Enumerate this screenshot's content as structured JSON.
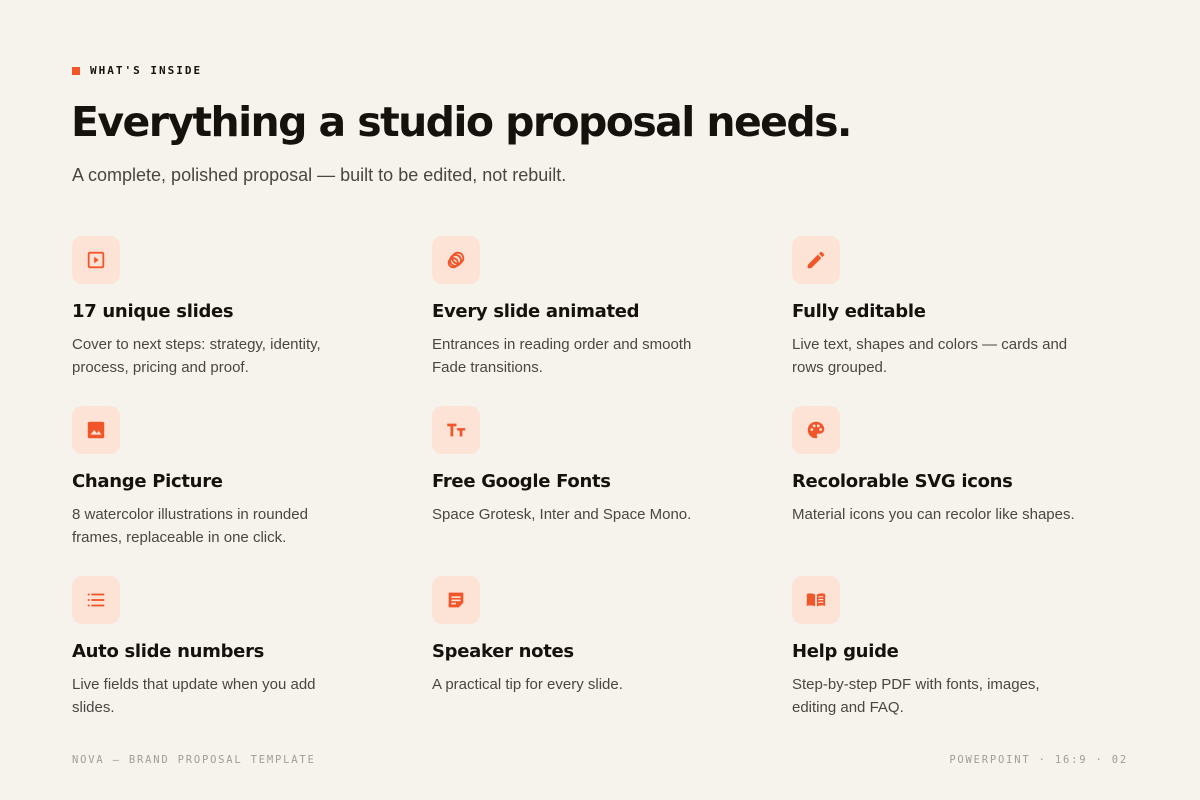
{
  "eyebrow": "WHAT'S INSIDE",
  "title": "Everything a studio proposal needs.",
  "subtitle": "A complete, polished proposal — built to be edited, not rebuilt.",
  "accent_color": "#f0562a",
  "features": [
    {
      "icon": "slideshow-icon",
      "title": "17 unique slides",
      "desc": "Cover to next steps: strategy, identity, process, pricing and proof."
    },
    {
      "icon": "animation-icon",
      "title": "Every slide animated",
      "desc": "Entrances in reading order and smooth Fade transitions."
    },
    {
      "icon": "edit-pencil-icon",
      "title": "Fully editable",
      "desc": "Live text, shapes and colors — cards and rows grouped."
    },
    {
      "icon": "image-icon",
      "title": "Change Picture",
      "desc": "8 watercolor illustrations in rounded frames, replaceable in one click."
    },
    {
      "icon": "text-fields-icon",
      "title": "Free Google Fonts",
      "desc": "Space Grotesk, Inter and Space Mono."
    },
    {
      "icon": "palette-icon",
      "title": "Recolorable SVG icons",
      "desc": "Material icons you can recolor like shapes."
    },
    {
      "icon": "numbered-list-icon",
      "title": "Auto slide numbers",
      "desc": "Live fields that update when you add slides."
    },
    {
      "icon": "sticky-note-icon",
      "title": "Speaker notes",
      "desc": "A practical tip for every slide."
    },
    {
      "icon": "book-icon",
      "title": "Help guide",
      "desc": "Step-by-step PDF with fonts, images, editing and FAQ."
    }
  ],
  "footer": {
    "left": "NOVA — BRAND PROPOSAL TEMPLATE",
    "right": "POWERPOINT · 16:9 · 02"
  }
}
